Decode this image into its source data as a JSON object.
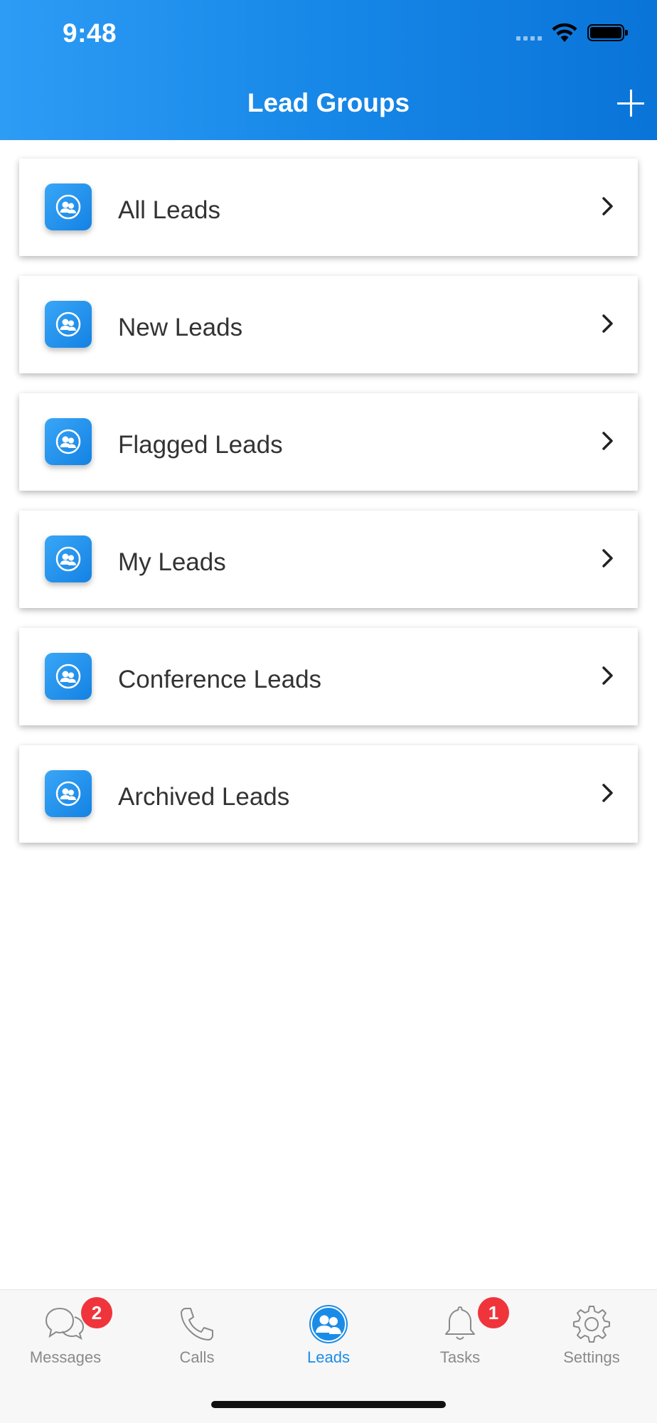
{
  "status_bar": {
    "time": "9:48"
  },
  "header": {
    "title": "Lead Groups",
    "add_icon": "plus-icon"
  },
  "lead_groups": [
    {
      "label": "All Leads",
      "icon": "users-icon"
    },
    {
      "label": "New Leads",
      "icon": "users-icon"
    },
    {
      "label": "Flagged Leads",
      "icon": "users-icon"
    },
    {
      "label": "My Leads",
      "icon": "users-icon"
    },
    {
      "label": "Conference Leads",
      "icon": "users-icon"
    },
    {
      "label": "Archived Leads",
      "icon": "users-icon"
    }
  ],
  "tabbar": {
    "tabs": [
      {
        "label": "Messages",
        "icon": "chat-bubbles-icon",
        "badge": "2",
        "active": false
      },
      {
        "label": "Calls",
        "icon": "phone-icon",
        "badge": "",
        "active": false
      },
      {
        "label": "Leads",
        "icon": "users-icon",
        "badge": "",
        "active": true
      },
      {
        "label": "Tasks",
        "icon": "bell-icon",
        "badge": "1",
        "active": false
      },
      {
        "label": "Settings",
        "icon": "gear-icon",
        "badge": "",
        "active": false
      }
    ]
  },
  "colors": {
    "accent": "#1a8ce8",
    "header_gradient_start": "#2d9cf5",
    "header_gradient_end": "#0a74d8",
    "badge": "#f0343c",
    "inactive_tab": "#8a8a8a"
  }
}
